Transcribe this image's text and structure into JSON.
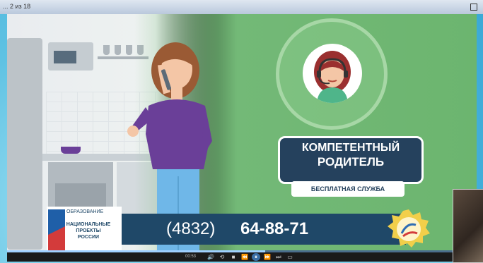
{
  "window": {
    "title": "... 2 из 18"
  },
  "video": {
    "badge": {
      "line1": "КОМПЕТЕНТНЫЙ",
      "line2": "РОДИТЕЛЬ",
      "sub": "БЕСПЛАТНАЯ СЛУЖБА"
    },
    "phone": {
      "prefix": "(4832)",
      "number": "64-88-71"
    },
    "national_project": {
      "top": "ОБРАЗОВАНИЕ",
      "line1": "НАЦИОНАЛЬНЫЕ",
      "line2": "ПРОЕКТЫ",
      "line3": "РОССИИ"
    }
  },
  "player": {
    "time": "00:53",
    "progress": 0.55,
    "controls": [
      {
        "name": "volume-icon",
        "glyph": "🔊"
      },
      {
        "name": "loop-icon",
        "glyph": "⟲"
      },
      {
        "name": "stop-icon",
        "glyph": "■"
      },
      {
        "name": "rewind-icon",
        "glyph": "⏪"
      },
      {
        "name": "pause-icon",
        "glyph": "⏸"
      },
      {
        "name": "forward-icon",
        "glyph": "⏩"
      },
      {
        "name": "next-icon",
        "glyph": "⏭"
      },
      {
        "name": "fullscreen-icon",
        "glyph": "▭"
      }
    ]
  },
  "colors": {
    "green": "#6cb56f",
    "navy": "#25415d",
    "bar": "#1f4868"
  }
}
